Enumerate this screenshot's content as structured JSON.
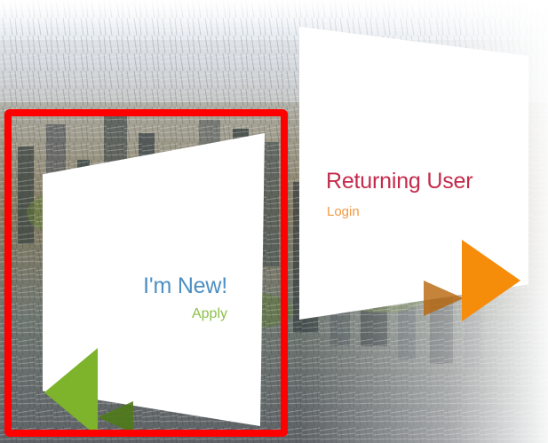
{
  "new_user": {
    "title": "I'm New!",
    "action": "Apply"
  },
  "returning_user": {
    "title": "Returning User",
    "action": "Login"
  },
  "colors": {
    "new_title": "#4d8fc2",
    "new_action": "#8dc04a",
    "new_triangle": "#7eb42b",
    "returning_title": "#c32b4b",
    "returning_action": "#f29a43",
    "returning_triangle": "#f58c0a",
    "highlight_border": "#ff0000"
  },
  "icons": {
    "new_user": "triangle-left-icon",
    "returning_user": "triangle-right-icon"
  }
}
